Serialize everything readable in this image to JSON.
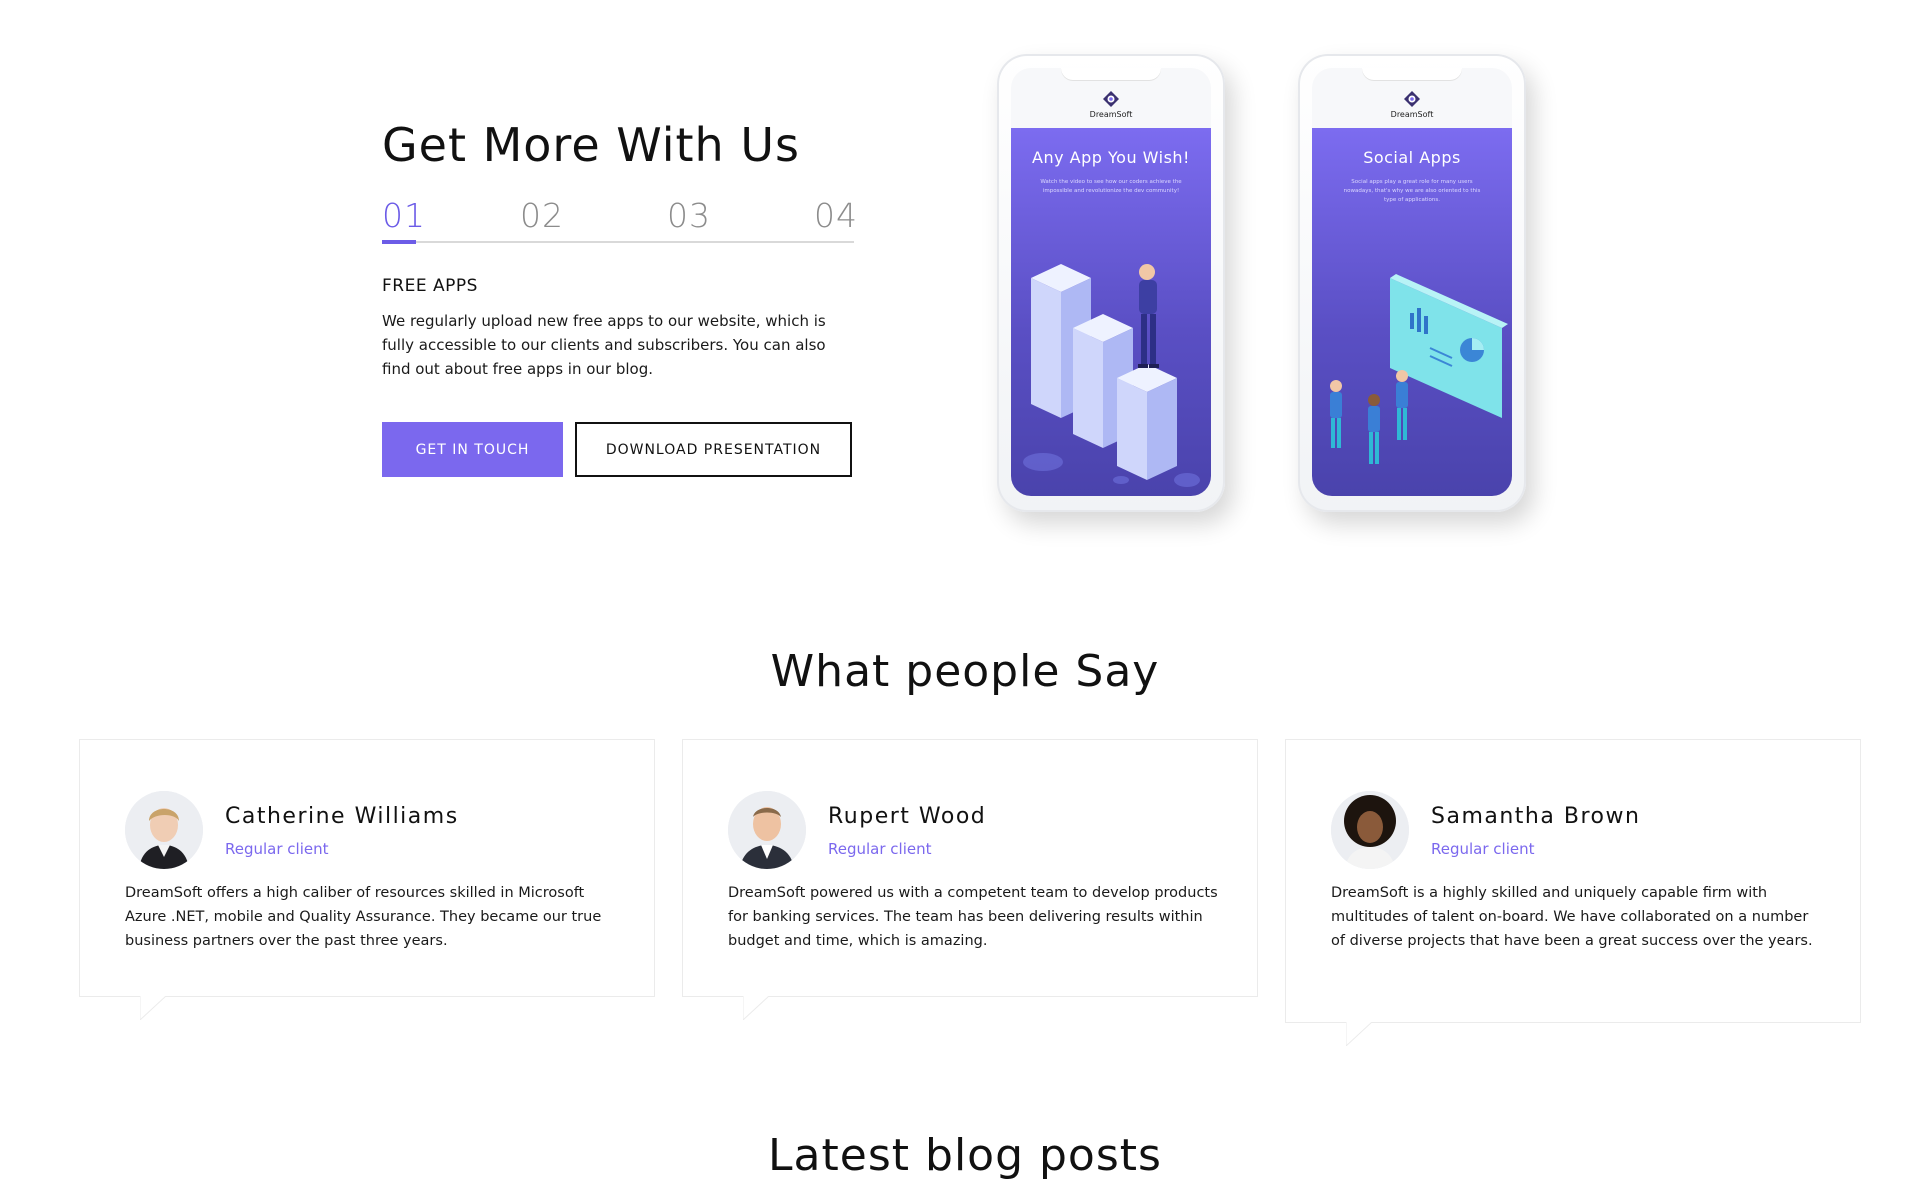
{
  "hero": {
    "title": "Get More With Us",
    "tabs": [
      "01",
      "02",
      "03",
      "04"
    ],
    "active_tab": "01",
    "feature_title": "FREE APPS",
    "feature_text": "We regularly upload new free apps to our website, which is fully accessible to our clients and subscribers. You can also find out about free apps in our blog.",
    "get_in_touch_label": "GET IN TOUCH",
    "download_label": "DOWNLOAD PRESENTATION"
  },
  "phones": [
    {
      "brand": "DreamSoft",
      "title": "Any App You Wish!",
      "text": "Watch the video to see how our coders achieve the impossible and revolutionize the dev community!"
    },
    {
      "brand": "DreamSoft",
      "title": "Social Apps",
      "text": "Social apps play a great role for many users nowadays, that's why we are also oriented to this type of applications."
    }
  ],
  "testimonials": {
    "title": "What people Say",
    "items": [
      {
        "name": "Catherine Williams",
        "role": "Regular client",
        "quote": "DreamSoft offers a high caliber of resources skilled in Microsoft Azure .NET, mobile and Quality Assurance. They became our true business partners over the past three years."
      },
      {
        "name": "Rupert Wood",
        "role": "Regular client",
        "quote": "DreamSoft powered us with a competent team to develop products for banking services. The team has been delivering results within budget and time, which is amazing."
      },
      {
        "name": "Samantha Brown",
        "role": "Regular client",
        "quote": "DreamSoft is a highly skilled and uniquely capable firm with multitudes of talent on-board. We have collaborated on a number of diverse projects that have been a great success over the years."
      }
    ]
  },
  "blog": {
    "title": "Latest blog posts"
  },
  "colors": {
    "accent": "#7b68ee",
    "accent_dark": "#6c5ce7",
    "text": "#111111"
  }
}
